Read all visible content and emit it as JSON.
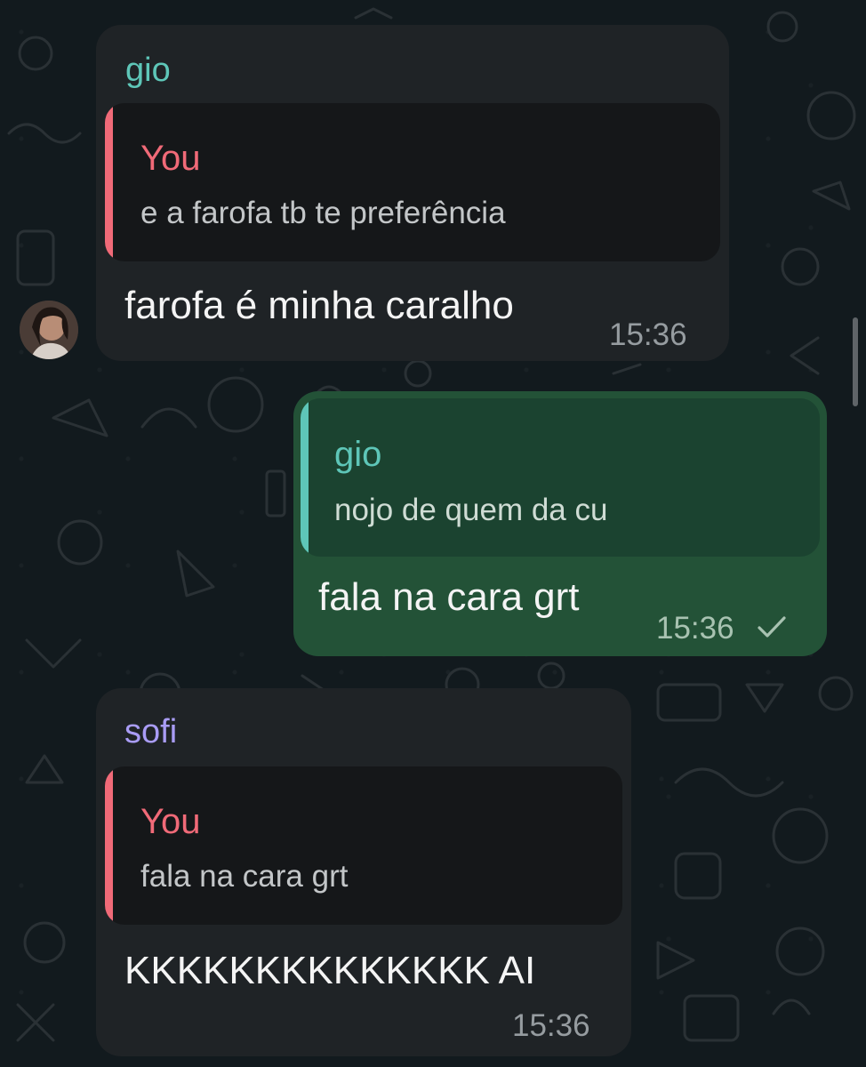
{
  "chat": {
    "messages": [
      {
        "sender": "gio",
        "reply_to": {
          "author": "You",
          "text": "e a farofa tb te preferência"
        },
        "text": "farofa é minha caralho",
        "time": "15:36"
      },
      {
        "reply_to": {
          "author": "gio",
          "text": "nojo de quem da cu"
        },
        "text": "fala na cara grt",
        "time": "15:36",
        "status": "sent"
      },
      {
        "sender": "sofi",
        "reply_to": {
          "author": "You",
          "text": "fala na cara grt"
        },
        "text": "KKKKKKKKKKKKKK AI",
        "time": "15:36"
      }
    ]
  },
  "colors": {
    "gio": "#5ec6b8",
    "sofi": "#a99cf5",
    "you": "#f06a78",
    "incoming_bubble": "#1f2326",
    "outgoing_bubble": "#235237",
    "background": "#121a1e"
  }
}
